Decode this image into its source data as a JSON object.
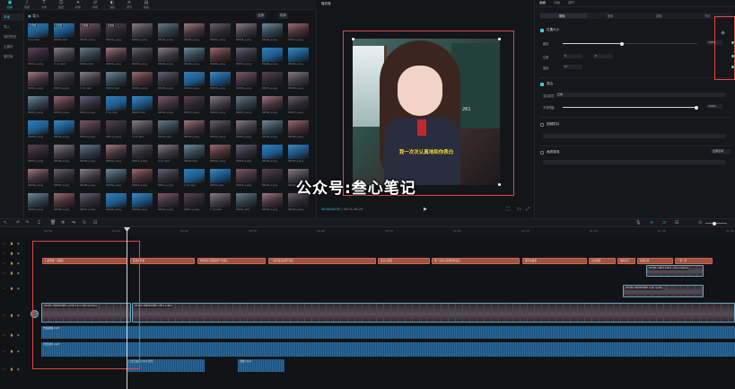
{
  "toolbar": {
    "buttons": [
      {
        "icon": "media-icon",
        "glyph": "▣",
        "label": "媒体",
        "active": true
      },
      {
        "icon": "audio-icon",
        "glyph": "♪",
        "label": "音频"
      },
      {
        "icon": "text-icon",
        "glyph": "T",
        "label": "文本"
      },
      {
        "icon": "sticker-icon",
        "glyph": "☺",
        "label": "贴纸"
      },
      {
        "icon": "effects-icon",
        "glyph": "✦",
        "label": "特效"
      },
      {
        "icon": "transition-icon",
        "glyph": "⇄",
        "label": "转场"
      },
      {
        "icon": "filter-icon",
        "glyph": "◐",
        "label": "滤镜"
      },
      {
        "icon": "adjust-icon",
        "glyph": "≋",
        "label": "调节"
      },
      {
        "icon": "template-icon",
        "glyph": "▤",
        "label": "模板"
      }
    ]
  },
  "leftnav": {
    "items": [
      {
        "label": "本地",
        "active": true
      },
      {
        "label": "导入"
      },
      {
        "label": "我的预设"
      },
      {
        "label": "云素材"
      },
      {
        "label": "素材库"
      }
    ]
  },
  "media": {
    "header": "导入",
    "sort_label": "全部",
    "filter_label": "排序",
    "thumbs": [
      {
        "cap": "0 (1).mp4",
        "badge": "已添加"
      },
      {
        "cap": "00001.mp4",
        "badge": "已添加"
      },
      {
        "cap": "00002_a.png",
        "badge": "已添加"
      },
      {
        "cap": "00003_a.png",
        "badge": "已添加"
      },
      {
        "cap": "00004_a.png",
        "badge": ""
      },
      {
        "cap": "00005_a.png",
        "badge": ""
      },
      {
        "cap": "00006_a.png",
        "badge": ""
      },
      {
        "cap": "00007_a.png",
        "badge": ""
      },
      {
        "cap": "00008_a.png",
        "badge": ""
      },
      {
        "cap": "00009_a.png",
        "badge": ""
      },
      {
        "cap": "00010_a.png",
        "badge": ""
      },
      {
        "cap": "00011_a.png",
        "badge": ""
      }
    ]
  },
  "player": {
    "title": "播放器",
    "timecode": "00:00:00:32",
    "duration": "00:01:46:29",
    "subtitle": "我一次次认真地和你表白",
    "board_num": "261"
  },
  "inspector": {
    "tabs": [
      "画面",
      "动画",
      "调节"
    ],
    "subtabs": [
      "基础",
      "抠像",
      "蒙版",
      "背景"
    ],
    "position_section": "位置大小",
    "scale_label": "缩放",
    "scale_value": "100%",
    "pos_label": "位置",
    "pos_x": "0",
    "pos_y": "0",
    "rotate_label": "旋转",
    "rotate_value": "0°",
    "blend_section": "混合",
    "blend_mode_label": "混合模式",
    "blend_mode_value": "正常",
    "opacity_label": "不透明度",
    "opacity_value": "100%",
    "stabilize_section": "视频防抖",
    "enhance_section": "画质增强",
    "enhance_value": "全部应用"
  },
  "timeline": {
    "ruler_ticks": [
      "00:00",
      "00:10",
      "00:20",
      "00:30",
      "00:40",
      "00:50",
      "01:00",
      "01:10",
      "01:20",
      "01:30",
      "01:40"
    ],
    "subtitle_clips": [
      "只爱你我一次跳着",
      "爱情这件事",
      "你在我心里面的那个位置上",
      "一段恋爱就这样写成了",
      "爱在心里面",
      "我一次次认真地和你表白",
      "我们的故事",
      "还在继续",
      "你的名字",
      "在我心里",
      "一生一世"
    ],
    "video_label": "00340-2600929001 perfect and delicate face",
    "video_label2": "00342-3600929001 Ultra avatar",
    "overlay_label1": "00345-1005133011 ultra-detailed",
    "overlay_label2": "00346-2600929001 best quality",
    "audio1": "伤感歌曲.mp3",
    "audio2": "背景音乐.mp3",
    "small_clip1": "二次元女孩.mp3 音乐",
    "small_clip2": "音效.mp3"
  },
  "watermark": "公众号:叁心笔记",
  "colors": {
    "accent": "#2fd3e0",
    "highlight": "#e04747",
    "subtitle_clip": "#a2503f",
    "audio": "#1c4f7a"
  }
}
